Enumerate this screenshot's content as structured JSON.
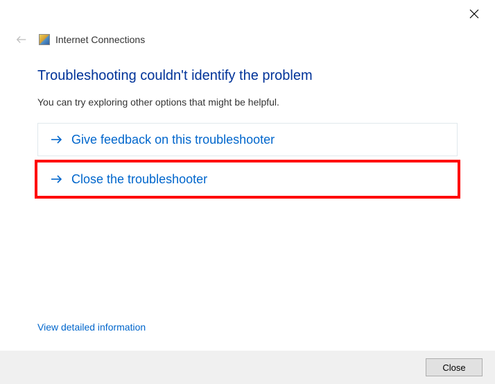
{
  "header": {
    "app_title": "Internet Connections"
  },
  "main": {
    "heading": "Troubleshooting couldn't identify the problem",
    "subtext": "You can try exploring other options that might be helpful.",
    "options": [
      {
        "label": "Give feedback on this troubleshooter"
      },
      {
        "label": "Close the troubleshooter"
      }
    ],
    "detail_link": "View detailed information"
  },
  "footer": {
    "close_label": "Close"
  }
}
